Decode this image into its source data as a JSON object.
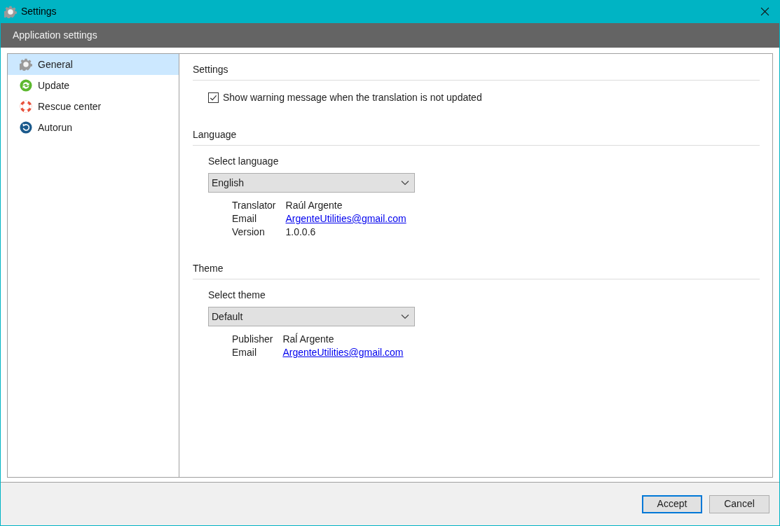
{
  "window": {
    "title": "Settings"
  },
  "header": {
    "title": "Application settings"
  },
  "sidebar": {
    "items": [
      {
        "label": "General",
        "kind": "gear",
        "selected": true
      },
      {
        "label": "Update",
        "kind": "update",
        "selected": false
      },
      {
        "label": "Rescue center",
        "kind": "rescue",
        "selected": false
      },
      {
        "label": "Autorun",
        "kind": "autorun",
        "selected": false
      }
    ]
  },
  "sections": [
    {
      "title": "Settings",
      "checkbox": {
        "label": "Show warning message when the translation is not updated",
        "checked": true
      }
    },
    {
      "title": "Language",
      "select": {
        "label": "Select language",
        "value": "English"
      },
      "info": [
        {
          "key": "Translator",
          "value": "Raúl Argente",
          "kind": "text"
        },
        {
          "key": "Email",
          "value": "ArgenteUtilities@gmail.com",
          "kind": "link"
        },
        {
          "key": "Version",
          "value": "1.0.0.6",
          "kind": "text"
        }
      ]
    },
    {
      "title": "Theme",
      "select": {
        "label": "Select theme",
        "value": "Default"
      },
      "info": [
        {
          "key": "Publisher",
          "value": "Raĺ Argente",
          "kind": "text"
        },
        {
          "key": "Email",
          "value": "ArgenteUtilities@gmail.com",
          "kind": "link"
        }
      ]
    }
  ],
  "buttons": [
    {
      "label": "Accept",
      "selected": true
    },
    {
      "label": "Cancel",
      "selected": false
    }
  ]
}
